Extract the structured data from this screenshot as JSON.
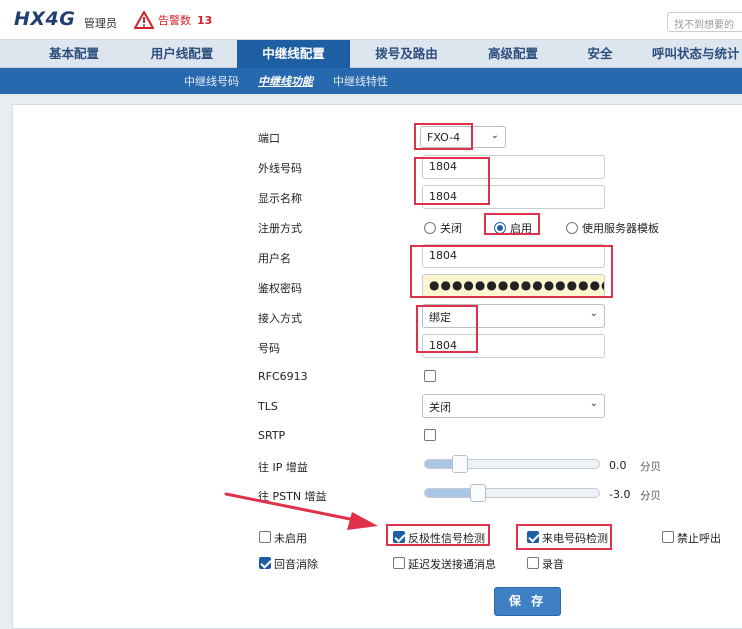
{
  "header": {
    "logo": "HX4G",
    "role": "管理员",
    "alarm_label": "告警数",
    "alarm_count": "13",
    "search_placeholder": "找不到想要的"
  },
  "nav": {
    "items": [
      {
        "label": "基本配置"
      },
      {
        "label": "用户线配置"
      },
      {
        "label": "中继线配置"
      },
      {
        "label": "拨号及路由"
      },
      {
        "label": "高级配置"
      },
      {
        "label": "安全"
      },
      {
        "label": "呼叫状态与统计"
      }
    ],
    "active_index": 2
  },
  "subnav": {
    "items": [
      {
        "label": "中继线号码"
      },
      {
        "label": "中继线功能"
      },
      {
        "label": "中继线特性"
      }
    ],
    "active_index": 1
  },
  "form": {
    "port_label": "端口",
    "port_value": "FXO-4",
    "outline_number_label": "外线号码",
    "outline_number_value": "1804",
    "display_name_label": "显示名称",
    "display_name_value": "1804",
    "register_label": "注册方式",
    "register_options": [
      "关闭",
      "启用",
      "使用服务器模板"
    ],
    "register_selected": "启用",
    "username_label": "用户名",
    "username_value": "1804",
    "auth_password_label": "鉴权密码",
    "auth_password_value": "●●●●●●●●●●●●●●●●●●●●",
    "access_mode_label": "接入方式",
    "access_mode_value": "绑定",
    "number_label": "号码",
    "number_value": "1804",
    "rfc6913_label": "RFC6913",
    "rfc6913_checked": false,
    "tls_label": "TLS",
    "tls_value": "关闭",
    "srtp_label": "SRTP",
    "srtp_checked": false,
    "ip_gain_label": "往 IP 增益",
    "ip_gain_value": "0.0",
    "ip_gain_unit": "分贝",
    "ip_gain_level": 0.2,
    "pstn_gain_label": "往 PSTN 增益",
    "pstn_gain_value": "-3.0",
    "pstn_gain_unit": "分贝",
    "pstn_gain_level": 0.3
  },
  "options": {
    "not_enabled": "未启用",
    "reverse_polarity": "反极性信号检测",
    "caller_id": "来电号码检测",
    "forbid_outgoing": "禁止呼出",
    "echo_cancel": "回音消除",
    "delay_send": "延迟发送接通消息",
    "record": "录音"
  },
  "save_label": "保 存",
  "colors": {
    "accent": "#1e5fa4",
    "highlight": "#e0304a",
    "alarm": "#d4202a"
  }
}
